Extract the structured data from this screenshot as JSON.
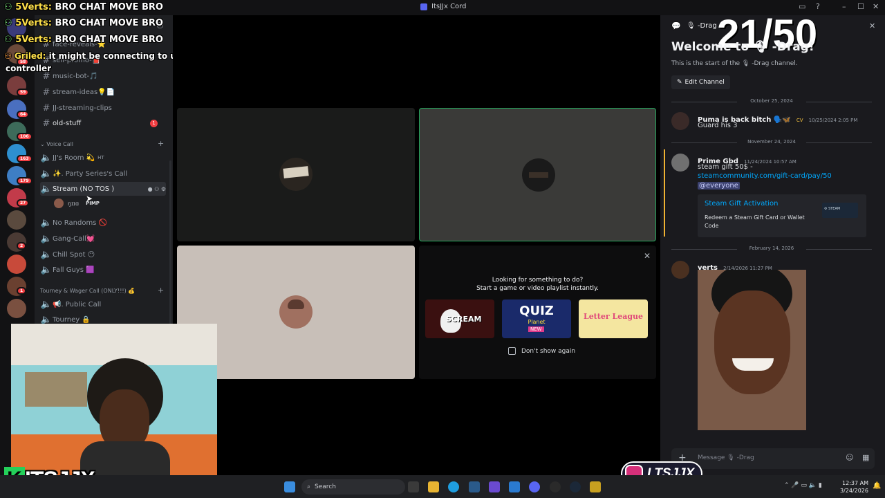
{
  "window": {
    "title": "ItsJJx Cord"
  },
  "counter": "21/50",
  "overlay_chat": [
    {
      "user": "5Verts:",
      "text": "BRO CHAT MOVE BRO"
    },
    {
      "user": "5Verts:",
      "text": "BRO CHAT MOVE BRO"
    },
    {
      "user": "5Verts:",
      "text": "BRO CHAT MOVE BRO"
    },
    {
      "user": "Griled:",
      "text": "it might be connecting to ur"
    },
    {
      "user": "",
      "text": "controller"
    }
  ],
  "server_badges": [
    "58",
    "59",
    "64",
    "106",
    "163",
    "179",
    "27",
    "2",
    "1"
  ],
  "channels": {
    "text_channels": [
      {
        "name": "face-reveals-⭐"
      },
      {
        "name": "self-promo-📕"
      },
      {
        "name": "music-bot-🎵"
      },
      {
        "name": "stream-ideas💡📄"
      },
      {
        "name": "JJ-streaming-clips"
      },
      {
        "name": "old-stuff",
        "unread": "1"
      }
    ],
    "voice_category": "Voice Call",
    "voice_channels": [
      {
        "name": "JJ's Room 💫",
        "tag": "HT"
      },
      {
        "name": "✨. Party Series's Call"
      },
      {
        "name": "Stream (NO TOS )"
      },
      {
        "name": "No Randoms 🚫"
      },
      {
        "name": "Gang-Call💓"
      },
      {
        "name": "Chill Spot 😶"
      },
      {
        "name": "Fall Guys 🟪"
      }
    ],
    "voice_member": {
      "name": "ŋɪɪɑ",
      "tag": "PIMP"
    },
    "tourney_category": "Tourney & Wager Call (ONLY!!!) 💰",
    "tourney_channels": [
      {
        "name": "📢. Public Call"
      },
      {
        "name": "Tourney 🔒"
      }
    ]
  },
  "activity": {
    "line1": "Looking for something to do?",
    "line2": "Start a game or video playlist instantly.",
    "games": [
      "SCREAM",
      "QUIZ Planet",
      "Letter League"
    ],
    "quiz_sub": "Planet",
    "quiz_new": "NEW",
    "dont_show": "Don't show again"
  },
  "panel": {
    "header": "-Drag",
    "welcome": "Welcome to 🎙 -Drag!",
    "start": "This is the start of the 🎙 -Drag channel.",
    "edit_button": "Edit Channel",
    "dates": [
      "October 25, 2024",
      "November 24, 2024",
      "February 14, 2026"
    ],
    "messages": [
      {
        "user": "Puma is back bitch 🗣️🦋",
        "badge": "CV",
        "time": "10/25/2024 2:05 PM",
        "body": "Guard his 3"
      },
      {
        "user": "Prime Gbd",
        "time": "11/24/2024 10:57 AM",
        "body": "steam gift 50$ - ",
        "link": "steamcommunity.com/gift-card/pay/50",
        "mention": "@everyone",
        "embed_title": "Steam Gift Activation",
        "embed_desc": "Redeem a Steam Gift Card or Wallet Code",
        "embed_brand": "STEAM"
      },
      {
        "user": "verts",
        "time": "2/14/2026 11:27 PM"
      }
    ],
    "input_placeholder": "Message 🎙 -Drag"
  },
  "taskbar": {
    "search": "Search",
    "time": "12:37 AM",
    "date": "3/24/2026"
  },
  "branding": {
    "stream_logo": "ITSJJX",
    "instagram": "LTSJJX"
  },
  "colors": {
    "accent": "#5865f2",
    "link": "#00a8fc",
    "mention_bg": "#3c4270",
    "unread": "#f23f43",
    "speaking": "#23a55a"
  }
}
